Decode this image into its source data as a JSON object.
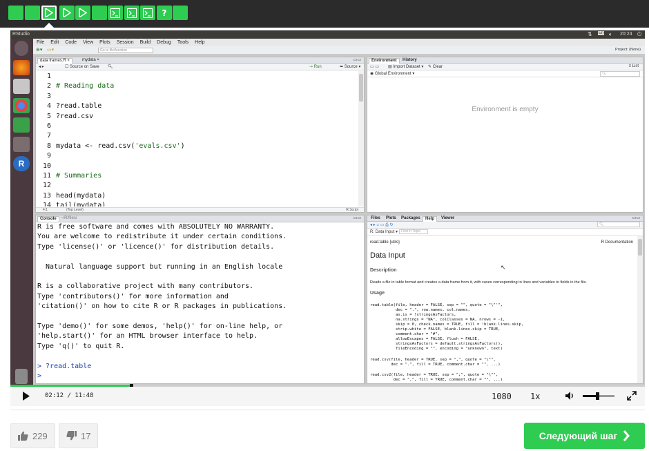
{
  "steps": [
    {
      "kind": "blank"
    },
    {
      "kind": "blank"
    },
    {
      "kind": "play",
      "active": true
    },
    {
      "kind": "play"
    },
    {
      "kind": "play"
    },
    {
      "kind": "blank"
    },
    {
      "kind": "terminal"
    },
    {
      "kind": "terminal"
    },
    {
      "kind": "terminal"
    },
    {
      "kind": "quiz",
      "label": "?"
    },
    {
      "kind": "blank"
    }
  ],
  "rstudio": {
    "window_title": "RStudio",
    "clock": "20:24",
    "lang": "En",
    "menu": [
      "File",
      "Edit",
      "Code",
      "View",
      "Plots",
      "Session",
      "Build",
      "Debug",
      "Tools",
      "Help"
    ],
    "goto_placeholder": "Go to file/function",
    "project": "Project: (None)",
    "editor": {
      "tabs": [
        "data frames.R",
        "mydata"
      ],
      "source_on_save": "Source on Save",
      "run": "Run",
      "source": "Source",
      "lines": [
        {
          "n": "1",
          "t": ""
        },
        {
          "n": "2",
          "t": "# Reading data"
        },
        {
          "n": "3",
          "t": ""
        },
        {
          "n": "4",
          "t": "?read.table"
        },
        {
          "n": "5",
          "t": "?read.csv"
        },
        {
          "n": "6",
          "t": ""
        },
        {
          "n": "7",
          "t": ""
        },
        {
          "n": "8",
          "t": "mydata <- read.csv('evals.csv')"
        },
        {
          "n": "9",
          "t": ""
        },
        {
          "n": "10",
          "t": ""
        },
        {
          "n": "11",
          "t": "# Summaries"
        },
        {
          "n": "12",
          "t": ""
        },
        {
          "n": "13",
          "t": "head(mydata)"
        },
        {
          "n": "14",
          "t": "tail(mydata)"
        }
      ],
      "status_pos": "4:1",
      "status_level": "(Top Level)",
      "status_type": "R Script"
    },
    "environment": {
      "tabs": [
        "Environment",
        "History"
      ],
      "import": "Import Dataset",
      "clear": "Clear",
      "list": "List",
      "scope": "Global Environment",
      "empty": "Environment is empty"
    },
    "console": {
      "tab": "Console",
      "path": "~/R/files/",
      "lines": [
        "R is free software and comes with ABSOLUTELY NO WARRANTY.",
        "You are welcome to redistribute it under certain conditions.",
        "Type 'license()' or 'licence()' for distribution details.",
        "",
        "  Natural language support but running in an English locale",
        "",
        "R is a collaborative project with many contributors.",
        "Type 'contributors()' for more information and",
        "'citation()' on how to cite R or R packages in publications.",
        "",
        "Type 'demo()' for some demos, 'help()' for on-line help, or",
        "'help.start()' for an HTML browser interface to help.",
        "Type 'q()' to quit R."
      ],
      "cmd": "> ?read.table",
      "prompt": ">"
    },
    "help": {
      "tabs": [
        "Files",
        "Plots",
        "Packages",
        "Help",
        "Viewer"
      ],
      "topic": "R: Data Input",
      "find": "Find in Topic",
      "header_left": "read.table {utils}",
      "header_right": "R Documentation",
      "title": "Data Input",
      "description_h": "Description",
      "description": "Reads a file in table format and creates a data frame from it, with cases corresponding to lines and variables to fields in the file.",
      "usage_h": "Usage",
      "usage1": [
        "read.table(file, header = FALSE, sep = \"\", quote = \"\\\"'\",",
        "           dec = \".\", row.names, col.names,",
        "           as.is = !stringsAsFactors,",
        "           na.strings = \"NA\", colClasses = NA, nrows = -1,",
        "           skip = 0, check.names = TRUE, fill = !blank.lines.skip,",
        "           strip.white = FALSE, blank.lines.skip = TRUE,",
        "           comment.char = \"#\",",
        "           allowEscapes = FALSE, flush = FALSE,",
        "           stringsAsFactors = default.stringsAsFactors(),",
        "           fileEncoding = \"\", encoding = \"unknown\", text)"
      ],
      "usage2": [
        "read.csv(file, header = TRUE, sep = \",\", quote = \"\\\"\",",
        "         dec = \".\", fill = TRUE, comment.char = \"\", ...)"
      ],
      "usage3": [
        "read.csv2(file, header = TRUE, sep = \";\", quote = \"\\\"\",",
        "          dec = \",\", fill = TRUE, comment.char = \"\", ...)"
      ]
    }
  },
  "player": {
    "progress": 0.19,
    "time": "02:12 / 11:48",
    "quality": "1080",
    "speed": "1x",
    "volume": 0.45
  },
  "feedback": {
    "likes": "229",
    "dislikes": "17"
  },
  "next_label": "Следующий шаг"
}
